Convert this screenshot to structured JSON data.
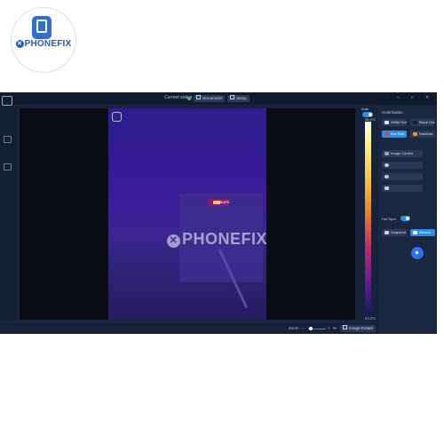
{
  "logo": {
    "text": "PHONEFIX",
    "mark": "✕"
  },
  "titlebar": {
    "status_label": "Current status",
    "disconnect_label": "Disconnect",
    "setup_label": "Setup",
    "controls": [
      "–",
      "□",
      "✕"
    ]
  },
  "viewer": {
    "hotspot_temp": "38.4°C",
    "scale_max": "38.4°C",
    "scale_min": "27.2°C",
    "auto_label": "Auto"
  },
  "sidebar": {
    "title": "Colorization",
    "palettes": [
      {
        "label": "White Hot",
        "swatch": "#e8e8e8"
      },
      {
        "label": "Black Hot",
        "swatch": "#202020"
      },
      {
        "label": "Iron Red",
        "swatch": "#e0462a"
      },
      {
        "label": "Rainbow",
        "swatch": "#ff8a2a"
      }
    ],
    "image_control_label": "Image Control",
    "hotspot_label": "Hot Spot",
    "snapshot_label": "Snapshot",
    "record_label": "Record"
  },
  "bottombar": {
    "zoom_label": "Zoom",
    "zoom_minus": "−",
    "zoom_plus": "+",
    "zoom_percent": "%",
    "image_rotate_label": "Image Rotate",
    "zoom_level": 0.15
  },
  "watermark": {
    "text": "PHONEFIX",
    "mark": "✕"
  },
  "colors": {
    "accent": "#2d8ee8",
    "window_bg": "#17233a",
    "status_ok": "#32c35a"
  }
}
